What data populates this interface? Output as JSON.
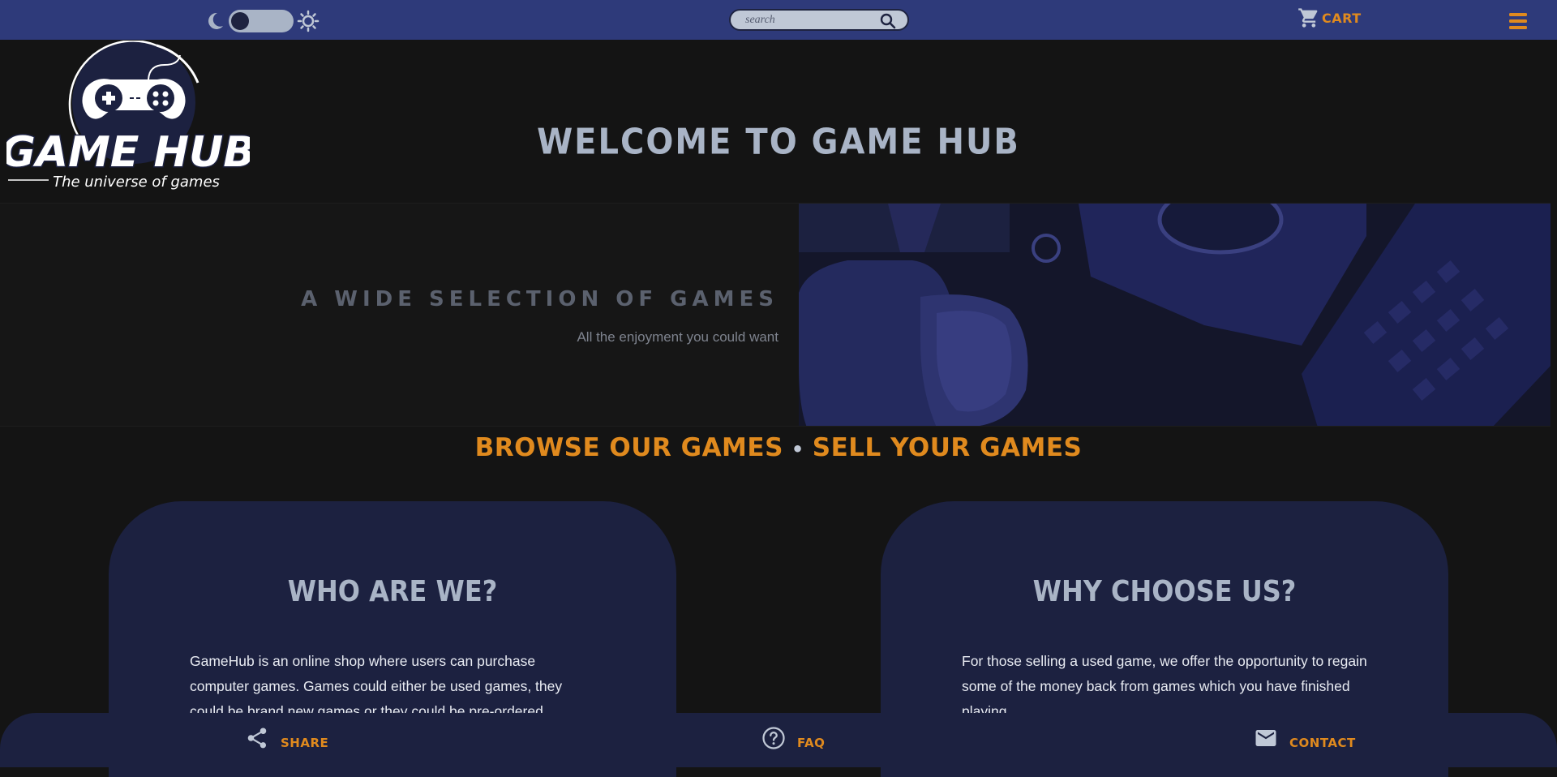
{
  "header": {
    "search": {
      "placeholder": "search",
      "value": ""
    },
    "cart_label": "CART"
  },
  "logo": {
    "title": "GAME HUB",
    "tagline": "The universe of games"
  },
  "welcome_title": "WELCOME TO GAME HUB",
  "hero": {
    "title": "A WIDE SELECTION OF GAMES",
    "subtitle": "All the enjoyment you could want"
  },
  "links": {
    "browse": "BROWSE OUR GAMES",
    "separator": "•",
    "sell": "SELL YOUR GAMES"
  },
  "cards": [
    {
      "title": "WHO ARE WE?",
      "text": "GameHub is an online shop where users can purchase computer games. Games could either be used games, they could be brand new games or they could be pre-ordered"
    },
    {
      "title": "WHY CHOOSE US?",
      "text": "For those selling a used game, we offer the opportunity to regain some of the money back from games which you have finished playing"
    }
  ],
  "footer": {
    "share": "SHARE",
    "faq": "FAQ",
    "contact": "CONTACT"
  },
  "colors": {
    "navbar": "#2e3a7a",
    "background": "#141414",
    "card": "#1c2140",
    "accent": "#e08a1e",
    "heading": "#a9b4c6"
  }
}
